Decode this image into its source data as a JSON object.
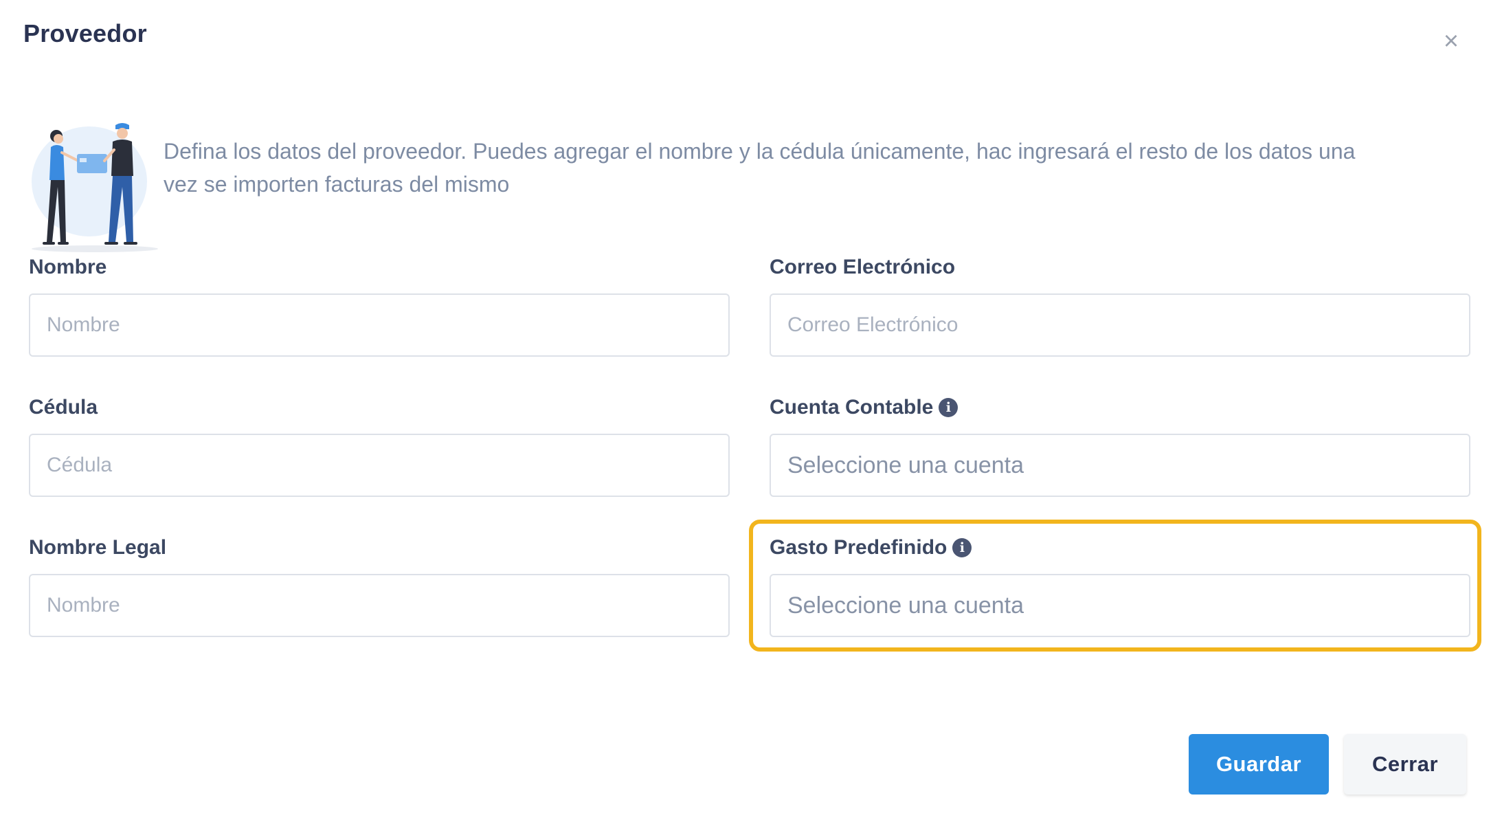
{
  "modal": {
    "title": "Proveedor",
    "close_icon": "×",
    "intro_text": "Defina los datos del proveedor. Puedes agregar el nombre y la cédula únicamente, hac ingresará el resto de los datos una vez se importen facturas del mismo"
  },
  "form": {
    "nombre": {
      "label": "Nombre",
      "placeholder": "Nombre",
      "value": ""
    },
    "correo": {
      "label": "Correo Electrónico",
      "placeholder": "Correo Electrónico",
      "value": ""
    },
    "cedula": {
      "label": "Cédula",
      "placeholder": "Cédula",
      "value": ""
    },
    "cuenta_contable": {
      "label": "Cuenta Contable",
      "selected": "Seleccione una cuenta",
      "icon": "info-icon"
    },
    "nombre_legal": {
      "label": "Nombre Legal",
      "placeholder": "Nombre",
      "value": ""
    },
    "gasto_predefinido": {
      "label": "Gasto Predefinido",
      "selected": "Seleccione una cuenta",
      "icon": "info-icon"
    }
  },
  "footer": {
    "save_label": "Guardar",
    "close_label": "Cerrar"
  },
  "colors": {
    "primary": "#2b8de0",
    "highlight": "#f2b51d",
    "title": "#2a3352"
  }
}
